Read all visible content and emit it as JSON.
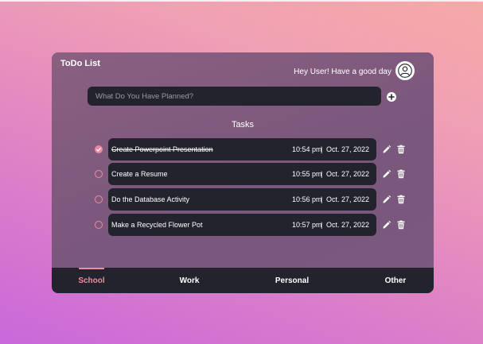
{
  "app": {
    "title": "ToDo List",
    "greeting": "Hey User! Have a good day"
  },
  "input": {
    "placeholder": "What Do You Have Planned?"
  },
  "tasks_heading": "Tasks",
  "tasks": [
    {
      "name": "Create Powerpoint Presentation",
      "time": "10:54 pm",
      "separator": "|",
      "date": "Oct. 27, 2022",
      "done": true
    },
    {
      "name": "Create a Resume",
      "time": "10:55 pm",
      "separator": "|",
      "date": "Oct. 27, 2022",
      "done": false
    },
    {
      "name": "Do the Database Activity",
      "time": "10:56 pm",
      "separator": "|",
      "date": "Oct. 27, 2022",
      "done": false
    },
    {
      "name": "Make a Recycled Flower Pot",
      "time": "10:57 pm",
      "separator": "|",
      "date": "Oct. 27, 2022",
      "done": false
    }
  ],
  "tabs": [
    {
      "label": "School",
      "active": true
    },
    {
      "label": "Work",
      "active": false
    },
    {
      "label": "Personal",
      "active": false
    },
    {
      "label": "Other",
      "active": false
    }
  ],
  "icons": {
    "avatar": "user-icon",
    "add": "plus-circle-icon",
    "edit": "pencil-icon",
    "delete": "trash-icon",
    "check": "checkmark-icon"
  },
  "colors": {
    "accent": "#f18aa1",
    "card": "#7a577c",
    "dark": "#23232d"
  }
}
